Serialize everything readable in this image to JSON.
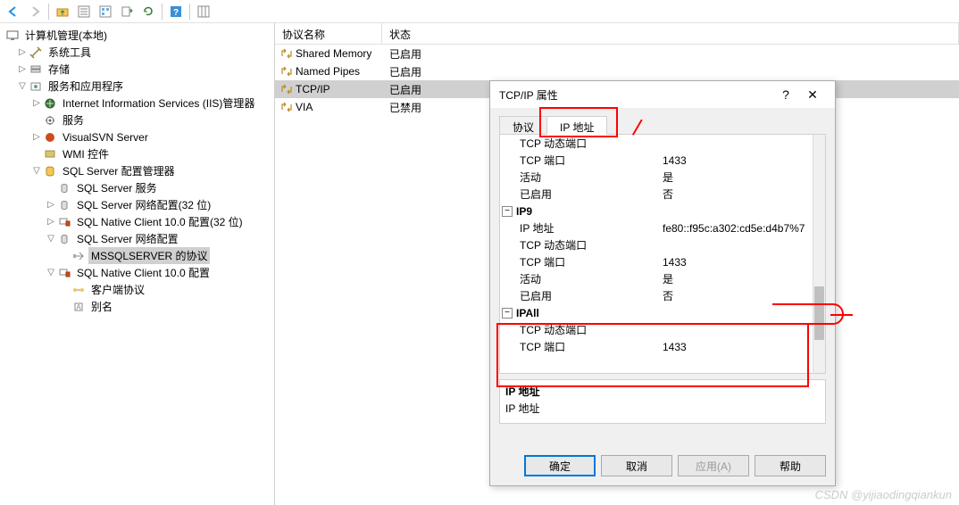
{
  "toolbar": {
    "icons": [
      "arrow-left",
      "arrow-right",
      "folder-up",
      "folder-view",
      "list-view",
      "export",
      "refresh",
      "sep",
      "help",
      "sep",
      "columns"
    ]
  },
  "tree": {
    "root": "计算机管理(本地)",
    "system_tools": "系统工具",
    "storage": "存储",
    "services_apps": "服务和应用程序",
    "iis": "Internet Information Services (IIS)管理器",
    "services": "服务",
    "visualsvn": "VisualSVN Server",
    "wmi": "WMI 控件",
    "sql_config_mgr": "SQL Server 配置管理器",
    "sql_services": "SQL Server 服务",
    "sql_net_32": "SQL Server 网络配置(32 位)",
    "sql_native_32": "SQL Native Client 10.0 配置(32 位)",
    "sql_net": "SQL Server 网络配置",
    "mssql_protocols": "MSSQLSERVER 的协议",
    "sql_native": "SQL Native Client 10.0 配置",
    "client_protocols": "客户端协议",
    "aliases": "别名"
  },
  "list": {
    "col_name": "协议名称",
    "col_status": "状态",
    "rows": [
      {
        "name": "Shared Memory",
        "status": "已启用",
        "selected": false
      },
      {
        "name": "Named Pipes",
        "status": "已启用",
        "selected": false
      },
      {
        "name": "TCP/IP",
        "status": "已启用",
        "selected": true
      },
      {
        "name": "VIA",
        "status": "已禁用",
        "selected": false
      }
    ]
  },
  "dialog": {
    "title": "TCP/IP 属性",
    "help": "?",
    "close": "✕",
    "tab_protocol": "协议",
    "tab_ip": "IP 地址",
    "desc_title": "IP 地址",
    "desc_text": "IP 地址",
    "btn_ok": "确定",
    "btn_cancel": "取消",
    "btn_apply": "应用(A)",
    "btn_help": "帮助",
    "props": [
      {
        "type": "row",
        "name": "TCP 动态端口",
        "value": ""
      },
      {
        "type": "row",
        "name": "TCP 端口",
        "value": "1433"
      },
      {
        "type": "row",
        "name": "活动",
        "value": "是"
      },
      {
        "type": "row",
        "name": "已启用",
        "value": "否"
      },
      {
        "type": "group",
        "name": "IP9"
      },
      {
        "type": "row",
        "name": "IP 地址",
        "value": "fe80::f95c:a302:cd5e:d4b7%7"
      },
      {
        "type": "row",
        "name": "TCP 动态端口",
        "value": ""
      },
      {
        "type": "row",
        "name": "TCP 端口",
        "value": "1433"
      },
      {
        "type": "row",
        "name": "活动",
        "value": "是"
      },
      {
        "type": "row",
        "name": "已启用",
        "value": "否"
      },
      {
        "type": "group",
        "name": "IPAll"
      },
      {
        "type": "row",
        "name": "TCP 动态端口",
        "value": ""
      },
      {
        "type": "row",
        "name": "TCP 端口",
        "value": "1433"
      }
    ]
  },
  "watermark": "CSDN @yijiaodingqiankun"
}
